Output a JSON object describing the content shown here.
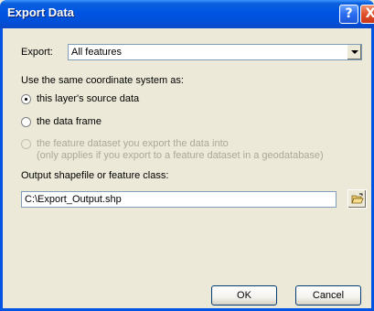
{
  "window": {
    "title": "Export Data",
    "help_label": "?",
    "close_label": "X"
  },
  "export": {
    "label": "Export:",
    "selected": "All features"
  },
  "coordinate_system": {
    "prompt": "Use the same coordinate system as:",
    "options": [
      {
        "label": "this layer's source data",
        "checked": true,
        "enabled": true
      },
      {
        "label": "the data frame",
        "checked": false,
        "enabled": true
      },
      {
        "label": "the feature dataset you export the data into",
        "sublabel": "(only applies if you export to a feature dataset in a geodatabase)",
        "checked": false,
        "enabled": false
      }
    ]
  },
  "output": {
    "label": "Output shapefile or feature class:",
    "value": "C:\\Export_Output.shp"
  },
  "buttons": {
    "ok": "OK",
    "cancel": "Cancel"
  },
  "icons": {
    "browse": "open-folder-icon"
  }
}
